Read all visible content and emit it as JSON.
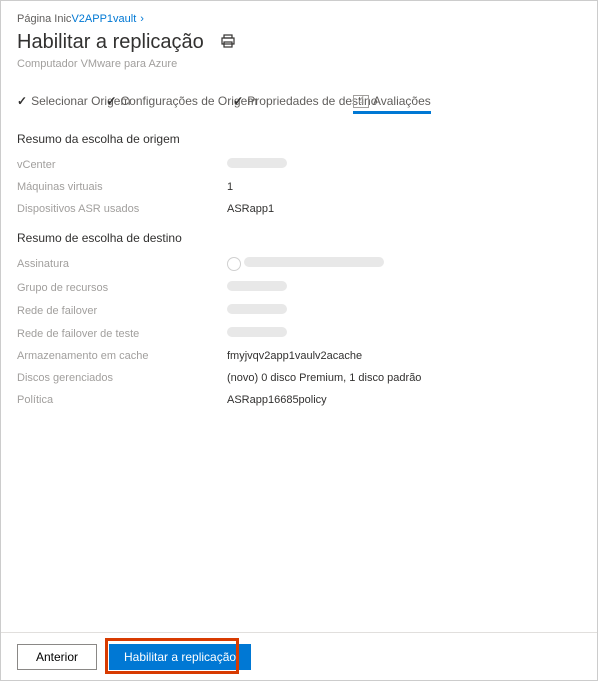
{
  "breadcrumb": {
    "prefix": "Página Inic",
    "link": "V2APP1vault"
  },
  "header": {
    "title": "Habilitar a replicação",
    "subtitle": "Computador VMware para Azure"
  },
  "steps": {
    "s1": "Selecionar Origem",
    "s2": "Configurações de Origem",
    "s3": "Propriedades de destino",
    "s4num": "4",
    "s4": "Avaliações"
  },
  "origin": {
    "title": "Resumo da escolha de origem",
    "r1_label": "vCenter",
    "r2_label": "Máquinas virtuais",
    "r2_value": "1",
    "r3_label": "Dispositivos ASR usados",
    "r3_value": "ASRapp1"
  },
  "dest": {
    "title": "Resumo de escolha de destino",
    "r1_label": "Assinatura",
    "r2_label": "Grupo de recursos",
    "r3_label": "Rede de failover",
    "r4_label": "Rede de failover de teste",
    "r5_label": "Armazenamento em cache",
    "r5_value": "fmyjvqv2app1vaulv2acache",
    "r6_label": "Discos gerenciados",
    "r6_value": "(novo) 0 disco Premium, 1 disco padrão",
    "r7_label": "Política",
    "r7_value": "ASRapp16685policy"
  },
  "footer": {
    "prev": "Anterior",
    "enable": "Habilitar a replicação"
  }
}
